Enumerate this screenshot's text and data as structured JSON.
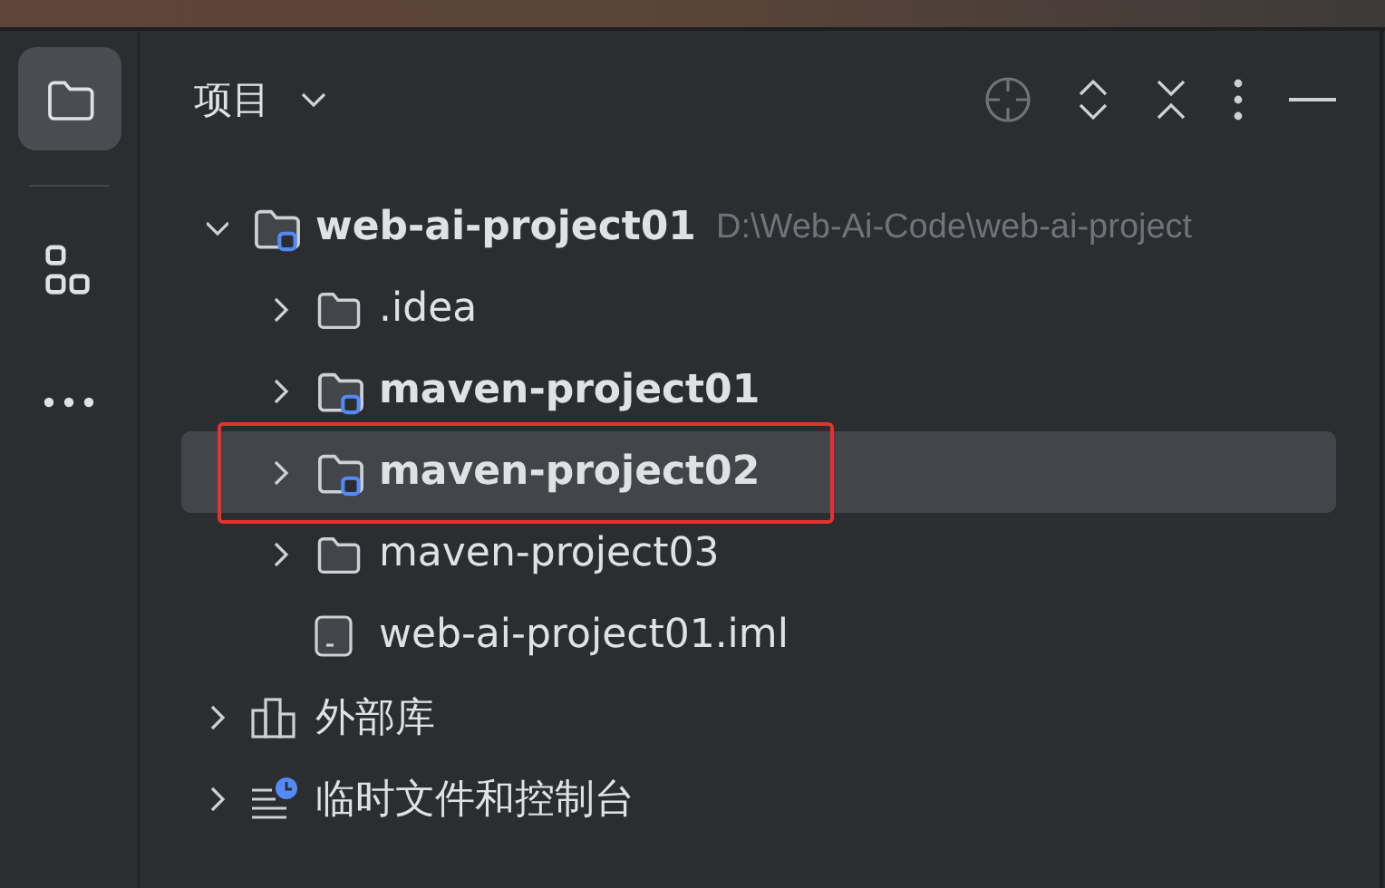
{
  "tool_strip": [
    {
      "kind": "project",
      "selected": true
    },
    {
      "kind": "structure",
      "selected": false
    },
    {
      "kind": "more",
      "selected": false
    }
  ],
  "panel": {
    "title": "项目",
    "toolbar": [
      {
        "kind": "locate"
      },
      {
        "kind": "expand"
      },
      {
        "kind": "collapse"
      },
      {
        "kind": "options"
      },
      {
        "kind": "hide"
      }
    ]
  },
  "tree": [
    {
      "label": "web-ai-project01",
      "path": "D:\\Web-Ai-Code\\web-ai-project",
      "kind": "module",
      "expanded": true,
      "selected": false,
      "outlined": false,
      "children": [
        {
          "label": ".idea",
          "kind": "folder",
          "expanded": false,
          "selected": false,
          "outlined": false
        },
        {
          "label": "maven-project01",
          "kind": "module",
          "expanded": false,
          "selected": false,
          "outlined": false
        },
        {
          "label": "maven-project02",
          "kind": "module",
          "expanded": false,
          "selected": true,
          "outlined": true
        },
        {
          "label": "maven-project03",
          "kind": "folder",
          "expanded": false,
          "selected": false,
          "outlined": false
        },
        {
          "label": "web-ai-project01.iml",
          "kind": "file",
          "selected": false,
          "outlined": false
        }
      ]
    },
    {
      "label": "外部库",
      "kind": "library",
      "expanded": false,
      "selected": false,
      "outlined": false
    },
    {
      "label": "临时文件和控制台",
      "kind": "scratch",
      "expanded": false,
      "selected": false,
      "outlined": false
    }
  ]
}
